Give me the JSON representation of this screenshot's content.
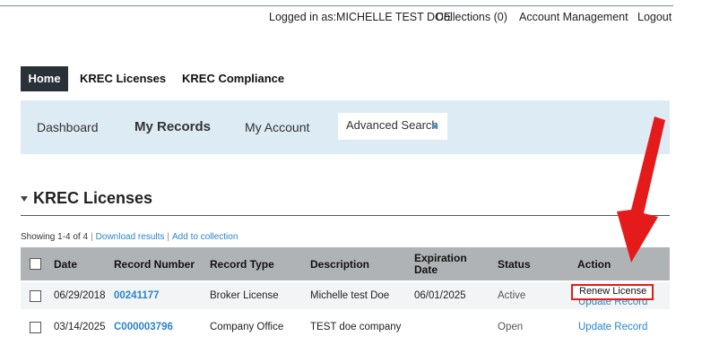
{
  "utility": {
    "logged_in": "Logged in as:MICHELLE TEST DOE",
    "collections": "Collections (0)",
    "account_management": "Account Management",
    "logout": "Logout"
  },
  "nav": {
    "tabs": [
      {
        "label": "Home",
        "active": true
      },
      {
        "label": "KREC Licenses"
      },
      {
        "label": "KREC Compliance"
      }
    ]
  },
  "subnav": {
    "dashboard": "Dashboard",
    "my_records": "My Records",
    "my_account": "My Account",
    "advanced_search": "Advanced Search"
  },
  "section": {
    "title": "KREC Licenses",
    "showing": "Showing 1-4 of 4",
    "download_results": "Download results",
    "add_to_collection": "Add to collection"
  },
  "table": {
    "headers": {
      "date": "Date",
      "record_number": "Record Number",
      "record_type": "Record Type",
      "description": "Description",
      "expiration_line1": "Expiration",
      "expiration_line2": "Date",
      "status": "Status",
      "action": "Action"
    },
    "rows": [
      {
        "date": "06/29/2018",
        "record_number": "00241177",
        "record_type": "Broker License",
        "description": "Michelle test Doe",
        "expiration": "06/01/2025",
        "status": "Active",
        "action_primary": "Renew License",
        "action_secondary": "Update Record"
      },
      {
        "date": "03/14/2025",
        "record_number": "C000003796",
        "record_type": "Company Office",
        "description": "TEST doe company",
        "expiration": "",
        "status": "Open",
        "action_primary": "Update Record"
      }
    ]
  },
  "colors": {
    "accent_link": "#2a84c8",
    "highlight": "#e51b1b",
    "nav_active": "#2b3138",
    "subnav_bg": "#ddebf5",
    "table_header": "#b0b3b5"
  },
  "icons": {
    "section_toggle": "caret-down-icon",
    "advanced_search_toggle": "caret-down-icon",
    "annotation": "red-arrow-icon"
  }
}
